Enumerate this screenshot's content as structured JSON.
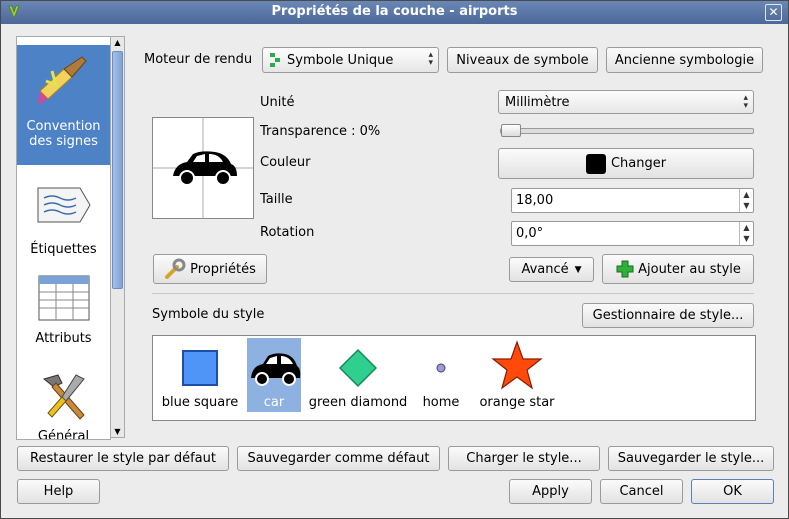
{
  "window": {
    "title": "Propriétés de la couche - airports",
    "close_glyph": "✕"
  },
  "sidebar": {
    "items": [
      {
        "label_line1": "Convention",
        "label_line2": "des signes",
        "icon": "brush-icon",
        "active": true
      },
      {
        "label": "Étiquettes",
        "icon": "label-tag-icon"
      },
      {
        "label": "Attributs",
        "icon": "table-icon"
      },
      {
        "label": "Général",
        "icon": "tools-icon"
      }
    ]
  },
  "renderer": {
    "label": "Moteur de rendu",
    "value": "Symbole Unique",
    "levels_button": "Niveaux de symbole",
    "old_symbology_button": "Ancienne symbologie"
  },
  "symbol": {
    "unit_label": "Unité",
    "unit_value": "Millimètre",
    "transparency_label": "Transparence : 0%",
    "transparency_value": 0,
    "color_label": "Couleur",
    "color_button": "Changer",
    "color_value": "#000000",
    "size_label": "Taille",
    "size_value": "18,00",
    "rotation_label": "Rotation",
    "rotation_value": "0,0°",
    "properties_button": "Propriétés",
    "advanced_button": "Avancé",
    "add_to_style_button": "Ajouter au style"
  },
  "style": {
    "label": "Symbole du style",
    "manager_button": "Gestionnaire de style...",
    "symbols": [
      {
        "name": "blue square",
        "color": "#4f95f7"
      },
      {
        "name": "car",
        "color": "#000000",
        "selected": true
      },
      {
        "name": "green diamond",
        "color": "#2fcf8f"
      },
      {
        "name": "home",
        "color": "#9b9be0"
      },
      {
        "name": "orange star",
        "color": "#ff4a0a"
      }
    ]
  },
  "footer": {
    "restore_default": "Restaurer le style par défaut",
    "save_default": "Sauvegarder comme défaut",
    "load_style": "Charger le style...",
    "save_style": "Sauvegarder le style...",
    "help": "Help",
    "apply": "Apply",
    "cancel": "Cancel",
    "ok": "OK"
  }
}
